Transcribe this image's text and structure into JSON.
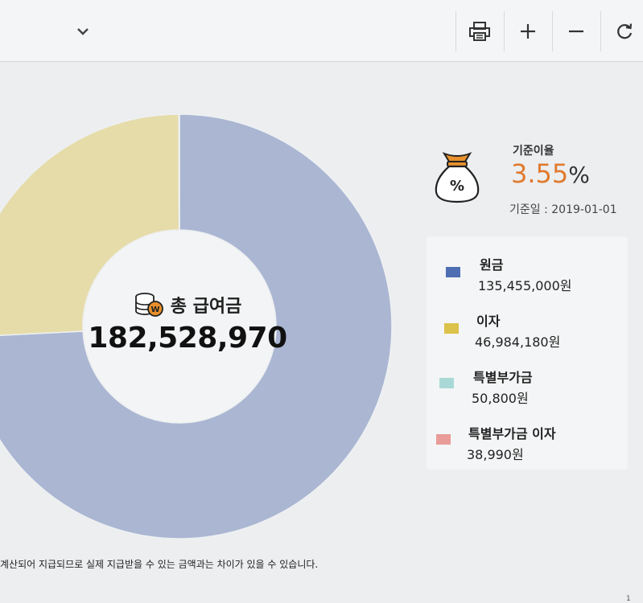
{
  "toolbar": {
    "dropdown_icon": "chevron-down-icon",
    "buttons": [
      {
        "name": "print-button",
        "icon": "printer-icon"
      },
      {
        "name": "zoom-in-button",
        "icon": "plus-icon"
      },
      {
        "name": "zoom-out-button",
        "icon": "minus-icon"
      },
      {
        "name": "refresh-button",
        "icon": "refresh-icon"
      }
    ]
  },
  "summary": {
    "title": "총 급여금",
    "total": "182,528,970",
    "icon": "coins-won-icon"
  },
  "rate": {
    "label": "기준이율",
    "value": "3.55",
    "unit": "%",
    "date_text": "기준일 : 2019-01-01",
    "icon": "money-bag-percent-icon"
  },
  "chart_data": {
    "type": "pie",
    "categories": [
      "원금",
      "이자",
      "특별부가금",
      "특별부가금 이자"
    ],
    "values": [
      135455000,
      46984180,
      50800,
      38990
    ],
    "colors": [
      "#aab6d2",
      "#e6dcaa",
      "#a9d9d6",
      "#e99c97"
    ]
  },
  "legend": {
    "items": [
      {
        "name": "원금",
        "value": "135,455,000원",
        "color": "#4f6fb3"
      },
      {
        "name": "이자",
        "value": "46,984,180원",
        "color": "#dcc24a"
      },
      {
        "name": "특별부가금",
        "value": "50,800원",
        "color": "#a9d9d6"
      },
      {
        "name": "특별부가금 이자",
        "value": "38,990원",
        "color": "#e99c97"
      }
    ]
  },
  "footnote": "계산되어 지급되므로 실제 지급받을 수 있는 금액과는 차이가 있을 수 있습니다.",
  "corner_text": "1"
}
